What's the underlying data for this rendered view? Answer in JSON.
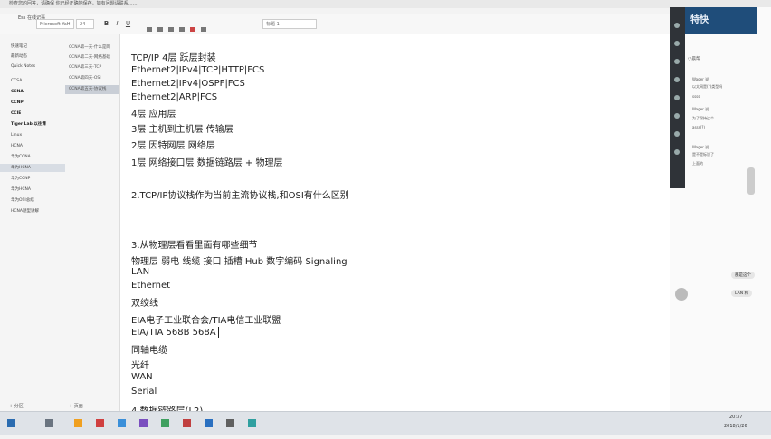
{
  "titlebar": {
    "text": "检查您的回答，请确保 你已经正确地保存，如有问题请联系……"
  },
  "toolbar": {
    "section_label": "Ess 在线记事",
    "font_name": "Microsoft YaH",
    "font_size": "24",
    "bold": "B",
    "italic": "I",
    "underline": "U",
    "style_label": "标题 1"
  },
  "sidebar": {
    "sections": [
      {
        "label": "快速笔记",
        "bold": false
      },
      {
        "label": "最新动态",
        "bold": false
      },
      {
        "label": "Quick Notes",
        "bold": false
      },
      {
        "label": "CCSA",
        "bold": false
      },
      {
        "label": "CCNA",
        "bold": true
      },
      {
        "label": "CCNP",
        "bold": true
      },
      {
        "label": "CCIE",
        "bold": true
      },
      {
        "label": "Tiger Lab 以往课",
        "bold": true
      },
      {
        "label": "Linux",
        "bold": false
      },
      {
        "label": "HCNA",
        "bold": false
      },
      {
        "label": "华为CCNA",
        "bold": false
      },
      {
        "label": "华为HCNA",
        "bold": false
      },
      {
        "label": "华为CCNP",
        "bold": false
      },
      {
        "label": "华为HCNA",
        "bold": false
      },
      {
        "label": "华为OSI总结",
        "bold": false
      },
      {
        "label": "HCNA题型讲解",
        "bold": false
      }
    ],
    "pages": [
      "CCNA第一天-什么是网",
      "CCNA第二天-网络基础",
      "CCNA第三天-TCP",
      "CCNA第四天-OSI",
      "CCNA第五天-协议栈"
    ],
    "add_section": "+ 分区",
    "add_page": "+ 页面"
  },
  "document": {
    "lines": [
      "TCP/IP  4层  跃层封装",
      "Ethernet2|IPv4|TCP|HTTP|FCS",
      "Ethernet2|IPv4|OSPF|FCS",
      "Ethernet2|ARP|FCS",
      "4层 应用层",
      "3层 主机到主机层    传输层",
      "2层 因特网层            网络层",
      "1层 网络接口层        数据链路层 + 物理层",
      "2.TCP/IP协议栈作为当前主流协议栈,和OSI有什么区别",
      "3.从物理层看看里面有哪些细节",
      "物理层 弱电 线缆 接口  插槽  Hub 数字编码 Signaling",
      "LAN",
      "Ethernet",
      "双绞线",
      "EIA电子工业联合会/TIA电信工业联盟",
      "EIA/TIA 568B 568A",
      "同轴电缆",
      "光纤",
      "WAN",
      "Serial",
      "4.数据链路层(L2)"
    ]
  },
  "chat": {
    "header": "特快",
    "messages": [
      "Wager 说",
      "以太网是(?)类型吗",
      "ssss",
      "Wager 说",
      "为了保持这个",
      "asss(?)",
      "Wager 说",
      "是不是标识了",
      "上面的"
    ],
    "bubble1": "那是这个",
    "bubble2": "LAN 和",
    "status": "小晨帮"
  },
  "taskbar": {
    "time": "20:37",
    "date": "2018/1/26"
  }
}
